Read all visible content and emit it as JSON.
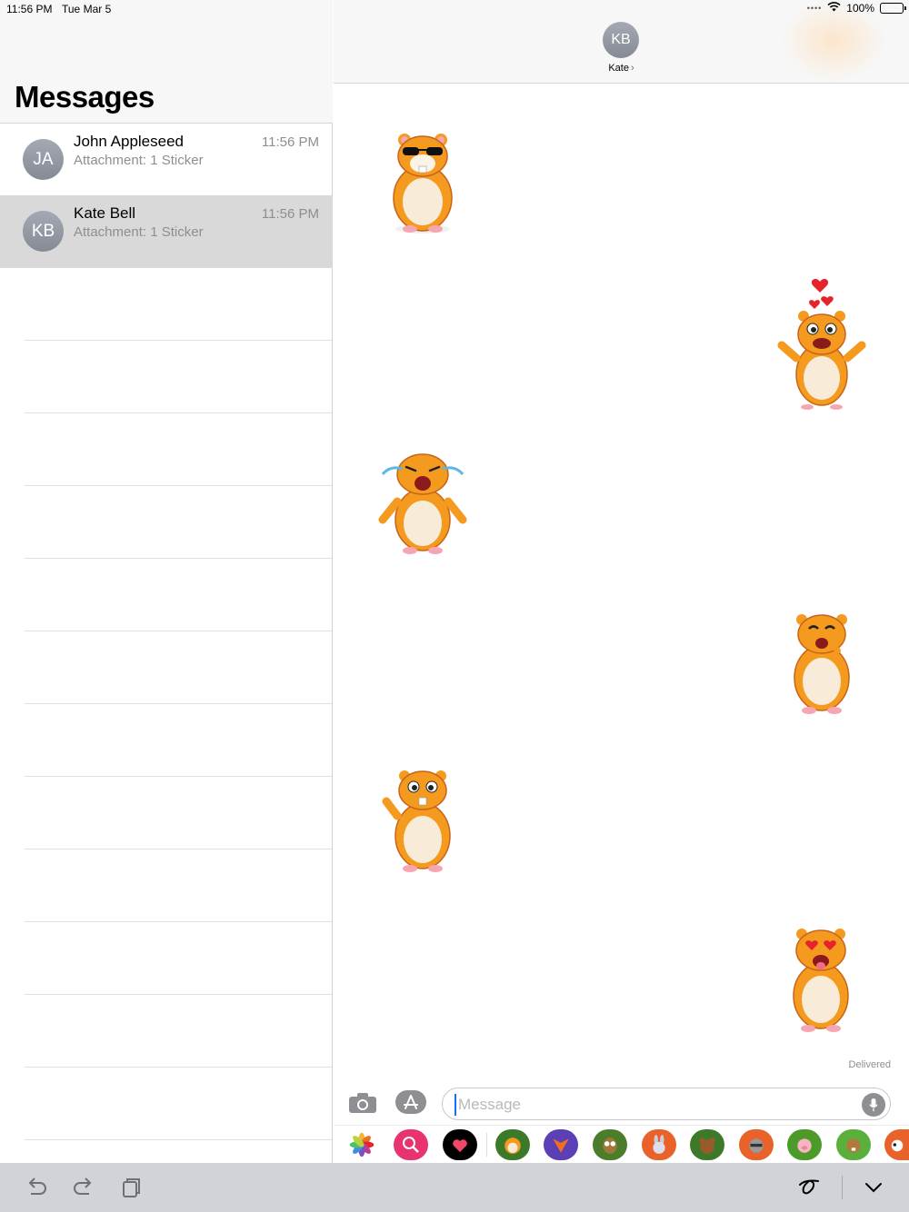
{
  "status_bar": {
    "time": "11:56 PM",
    "date": "Tue Mar 5",
    "battery": "100%"
  },
  "sidebar": {
    "title": "Messages",
    "conversations": [
      {
        "initials": "JA",
        "name": "John Appleseed",
        "preview": "Attachment: 1 Sticker",
        "time": "11:56 PM",
        "selected": false
      },
      {
        "initials": "KB",
        "name": "Kate Bell",
        "preview": "Attachment: 1 Sticker",
        "time": "11:56 PM",
        "selected": true
      }
    ]
  },
  "chat": {
    "contact_initials": "KB",
    "contact_name": "Kate",
    "messages": [
      {
        "side": "left",
        "sticker": "hamster-sunglasses-sticker"
      },
      {
        "side": "right",
        "sticker": "hamster-hearts-sticker"
      },
      {
        "side": "left",
        "sticker": "hamster-crying-sticker"
      },
      {
        "side": "right",
        "sticker": "hamster-laughing-sticker"
      },
      {
        "side": "left",
        "sticker": "hamster-waving-sticker"
      },
      {
        "side": "right",
        "sticker": "hamster-heart-eyes-sticker"
      }
    ],
    "delivered_label": "Delivered",
    "input": {
      "placeholder": "Message",
      "value": ""
    }
  },
  "app_drawer": [
    "photos-app-icon",
    "images-search-app-icon",
    "digital-touch-app-icon",
    "hamster-sticker-app-icon",
    "fox-sticker-app-icon",
    "owl-sticker-app-icon",
    "bunny-sticker-app-icon",
    "bear-sticker-app-icon",
    "raccoon-sticker-app-icon",
    "pig-sticker-app-icon",
    "beaver-sticker-app-icon",
    "panda-sticker-app-icon"
  ],
  "colors": {
    "accent": "#1a6cff",
    "selected_row": "#d9d9d9",
    "avatar": "#8e929c",
    "hamster_orange": "#f39a1f"
  }
}
